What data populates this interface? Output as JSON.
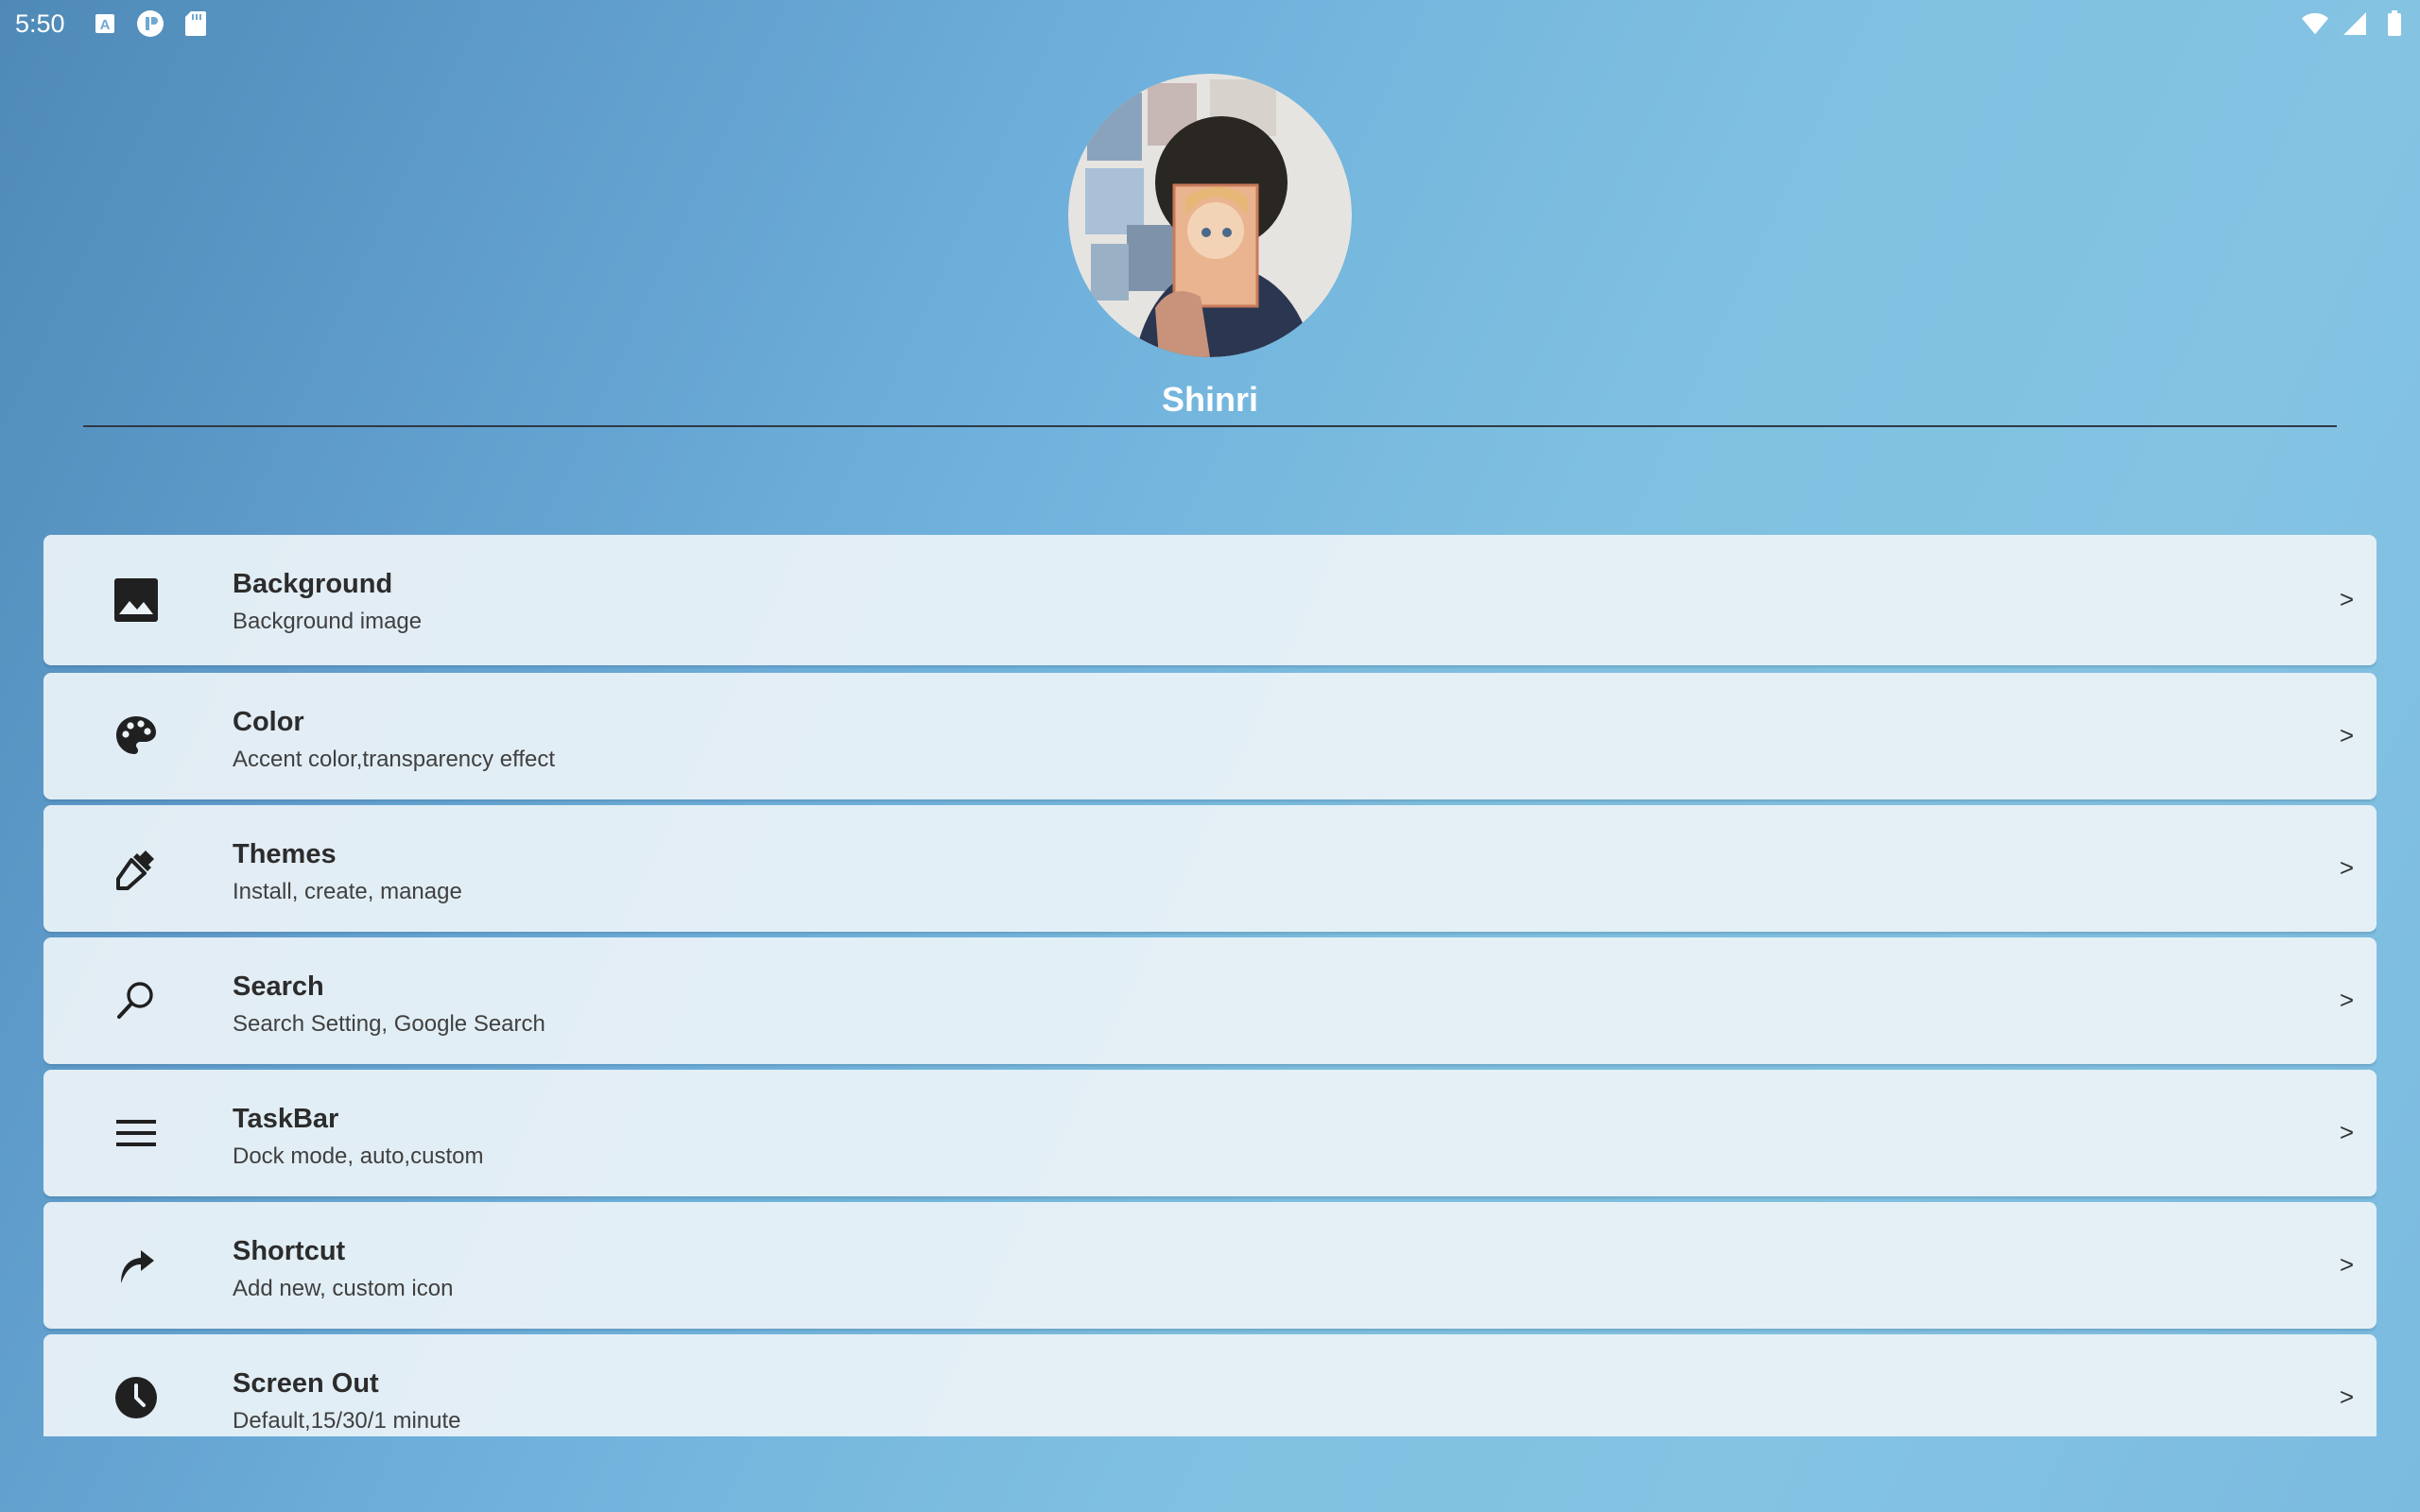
{
  "status_bar": {
    "time": "5:50",
    "left_icons": [
      "keyboard-a-icon",
      "app-notification-icon",
      "sd-card-icon"
    ],
    "right_icons": [
      "wifi-icon",
      "cell-signal-icon",
      "battery-icon"
    ]
  },
  "profile": {
    "name": "Shinri"
  },
  "settings": {
    "items": [
      {
        "title": "Background",
        "subtitle": "Background image",
        "icon": "image-icon",
        "chevron": ">"
      },
      {
        "title": "Color",
        "subtitle": "Accent color,transparency effect",
        "icon": "palette-icon",
        "chevron": ">"
      },
      {
        "title": "Themes",
        "subtitle": "Install, create, manage",
        "icon": "eyedropper-icon",
        "chevron": ">"
      },
      {
        "title": "Search",
        "subtitle": "Search Setting, Google Search",
        "icon": "search-icon",
        "chevron": ">"
      },
      {
        "title": "TaskBar",
        "subtitle": "Dock mode, auto,custom",
        "icon": "menu-icon",
        "chevron": ">"
      },
      {
        "title": "Shortcut",
        "subtitle": "Add new, custom icon",
        "icon": "shortcut-arrow-icon",
        "chevron": ">"
      },
      {
        "title": "Screen Out",
        "subtitle": "Default,15/30/1 minute",
        "icon": "clock-icon",
        "chevron": ">"
      }
    ]
  }
}
